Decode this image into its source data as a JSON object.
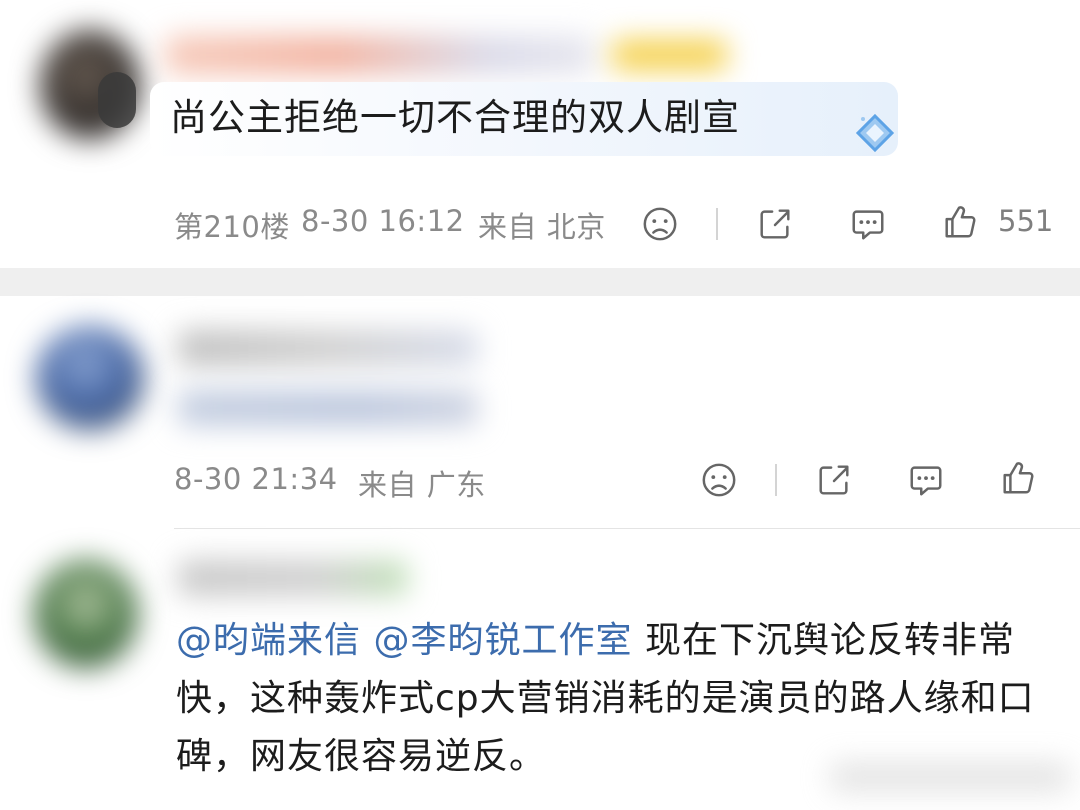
{
  "comments": [
    {
      "text": "尚公主拒绝一切不合理的双人剧宣",
      "floor": "第210楼",
      "time": "8-30 16:12",
      "source": "来自 北京",
      "like_count": "551"
    },
    {
      "time": "8-30 21:34",
      "source": "来自 广东"
    },
    {
      "mentions": [
        "@昀端来信",
        "@李昀锐工作室"
      ],
      "text": "现在下沉舆论反转非常快，这种轰炸式cp大营销消耗的是演员的路人缘和口碑，网友很容易逆反。"
    }
  ],
  "icons": {
    "dislike": "sad-face-icon",
    "share": "share-icon",
    "reply": "comment-bubble-icon",
    "like": "thumbs-up-icon"
  },
  "colors": {
    "mention": "#3c6cad",
    "meta_text": "#8a8a8a",
    "divider": "#efefef",
    "bubble": "#eef4fc"
  }
}
